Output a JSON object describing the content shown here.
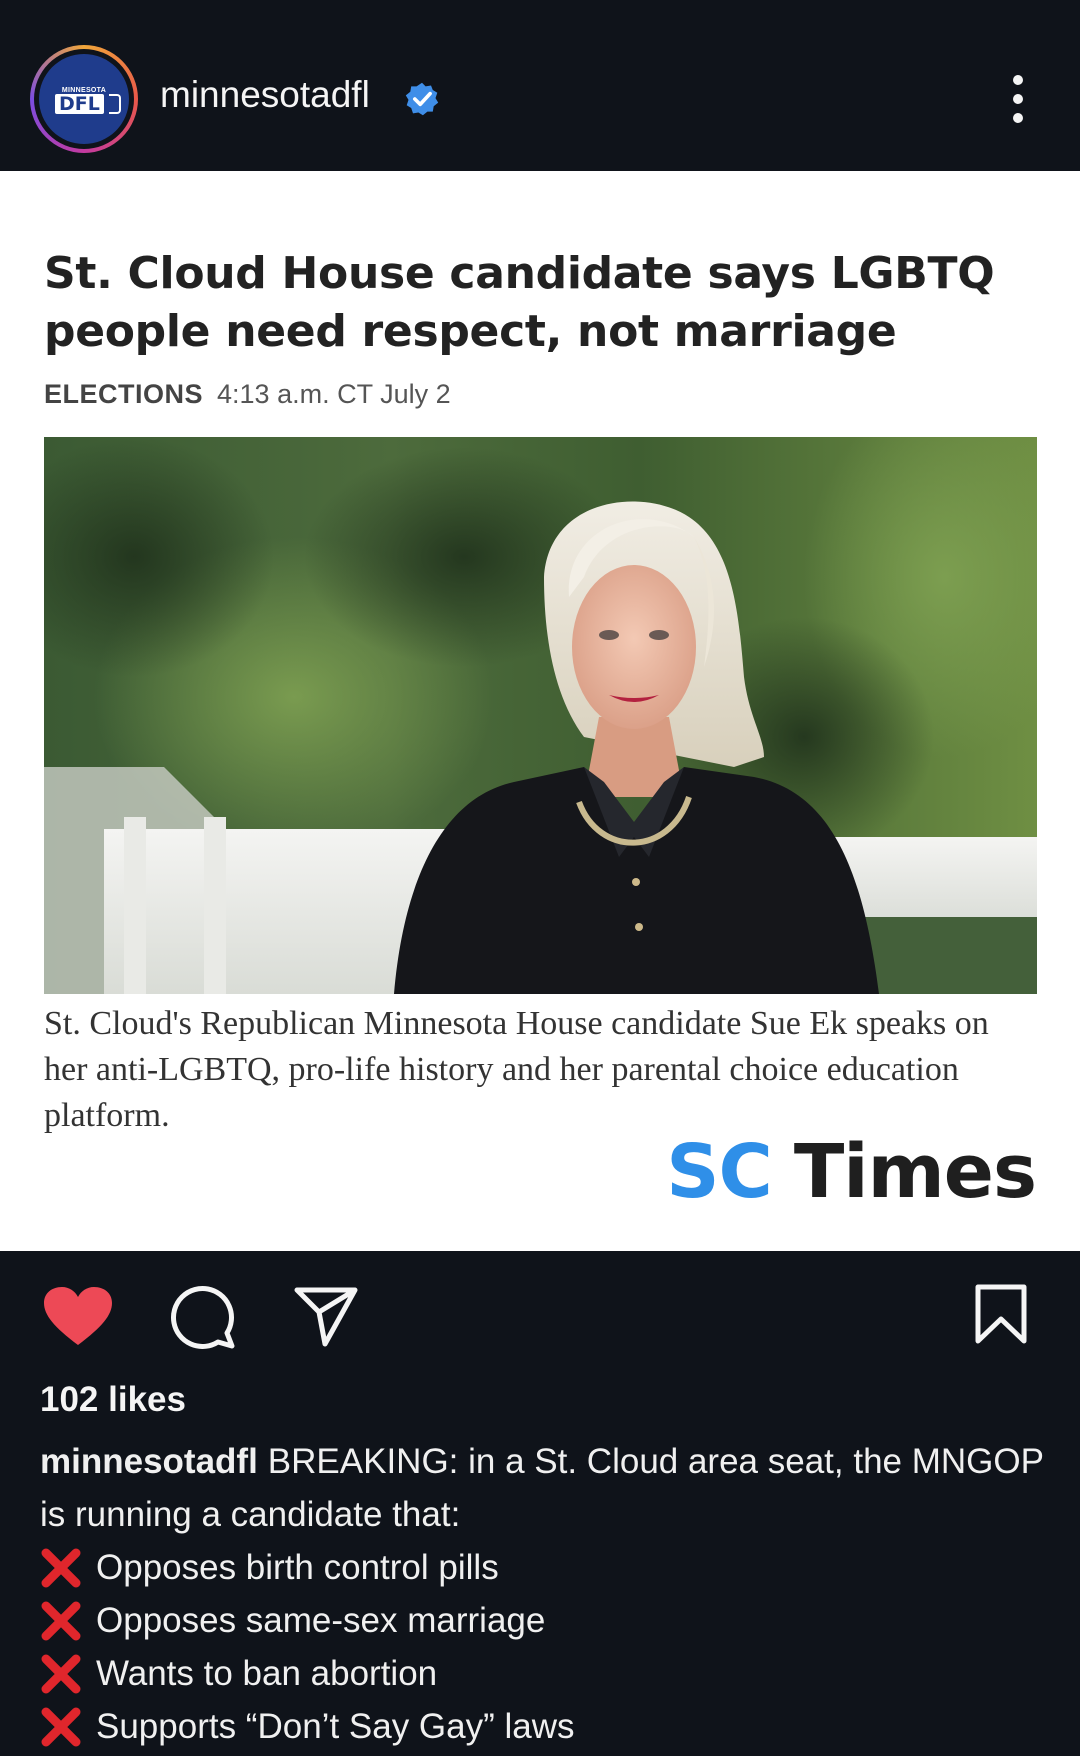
{
  "header": {
    "avatar_text_top": "MINNESOTA",
    "avatar_text_main": "DFL",
    "username": "minnesotadfl",
    "verified_icon": "verified-badge-icon",
    "more_icon": "more-vertical-icon"
  },
  "article": {
    "headline": "St. Cloud House candidate says LGBTQ people need respect, not marriage",
    "category": "ELECTIONS",
    "timestamp": "4:13 a.m. CT July 2",
    "caption": "St. Cloud's Republican Minnesota House candidate Sue Ek speaks on her anti-LGBTQ, pro-life history and her parental choice education platform.",
    "source_logo_sc": "SC",
    "source_logo_times": "Times"
  },
  "actions": {
    "like_icon": "heart-icon",
    "comment_icon": "comment-icon",
    "share_icon": "send-icon",
    "save_icon": "bookmark-icon",
    "liked_color": "#ed4956"
  },
  "post": {
    "likes": "102 likes",
    "username": "minnesotadfl",
    "text_intro": "BREAKING: in a St. Cloud area seat, the MNGOP is running a candidate that:",
    "bullets": [
      "Opposes birth control pills",
      "Opposes same-sex marriage",
      "Wants to ban abortion",
      "Supports “Don’t Say Gay” laws"
    ],
    "bullet_icon": "red-x-icon"
  }
}
